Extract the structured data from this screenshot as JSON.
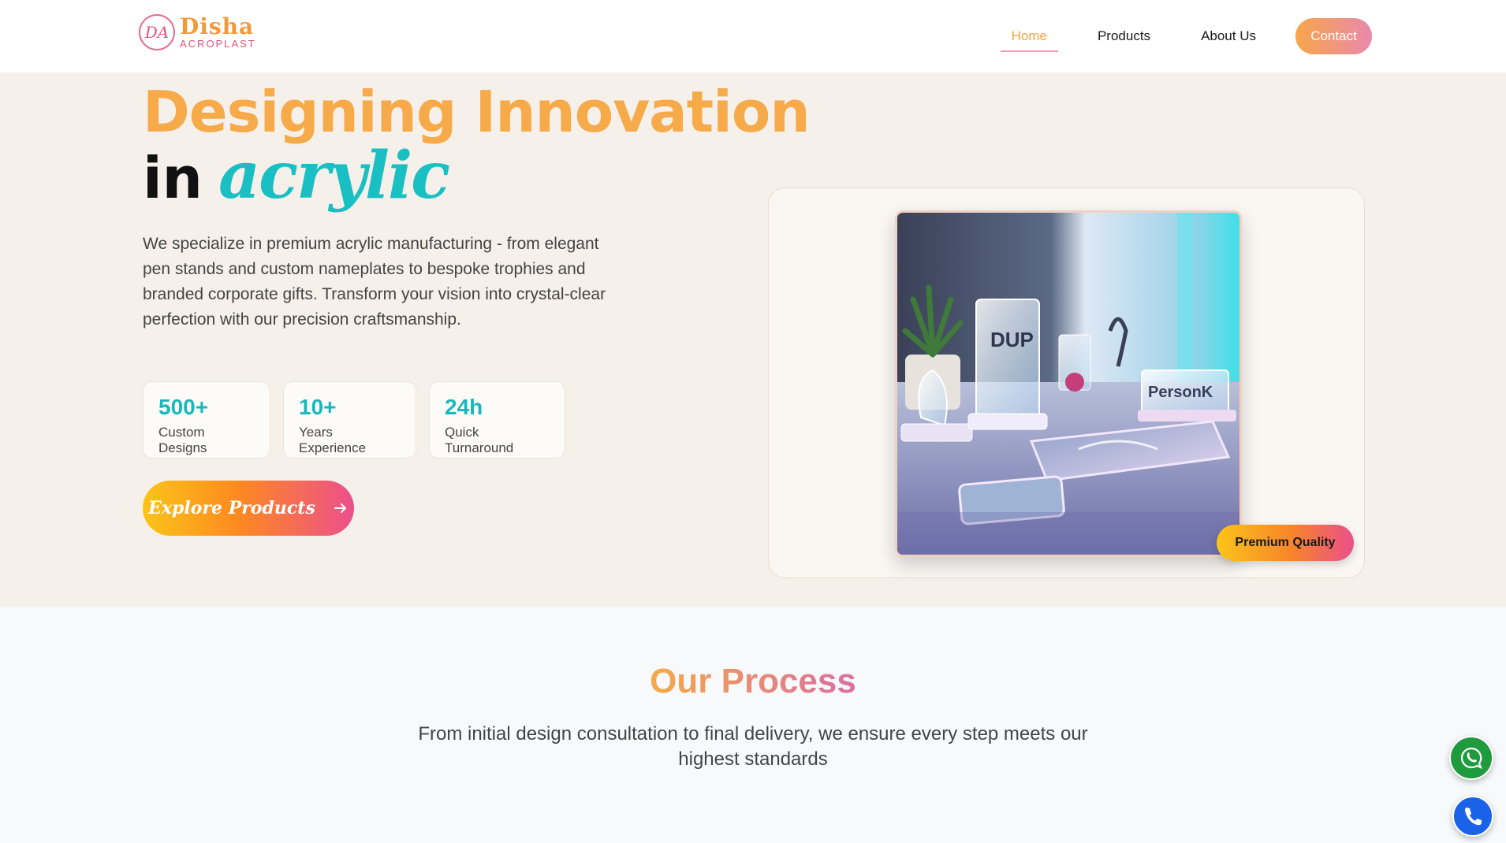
{
  "header": {
    "logo": {
      "mark": "DA",
      "name": "Disha",
      "sub": "ACROPLAST"
    },
    "nav": {
      "home": "Home",
      "products": "Products",
      "about": "About Us",
      "contact": "Contact"
    }
  },
  "hero": {
    "title_line1": "Designing Innovation",
    "title_in": "in",
    "title_acrylic": "acrylic",
    "description": "We specialize in premium acrylic manufacturing - from elegant pen stands and custom nameplates to bespoke trophies and branded corporate gifts. Transform your vision into crystal-clear perfection with our precision craftsmanship.",
    "stats": [
      {
        "value": "500+",
        "label": "Custom Designs"
      },
      {
        "value": "10+",
        "label": "Years Experience"
      },
      {
        "value": "24h",
        "label": "Quick Turnaround"
      }
    ],
    "cta": "Explore Products",
    "badge": "Premium Quality",
    "image_text": {
      "plaque1": "DUP",
      "plaque2": "PersonK"
    }
  },
  "process": {
    "title": "Our Process",
    "description": "From initial design consultation to final delivery, we ensure every step meets our highest standards"
  },
  "colors": {
    "accent_orange": "#f6aa4a",
    "accent_teal": "#19bfc3",
    "accent_pink": "#e989ac",
    "hero_bg": "#f5f0e9",
    "whatsapp": "#1f9b3e",
    "phone": "#1a63e8"
  },
  "icons": [
    "arrow-right-icon",
    "whatsapp-icon",
    "phone-icon"
  ]
}
